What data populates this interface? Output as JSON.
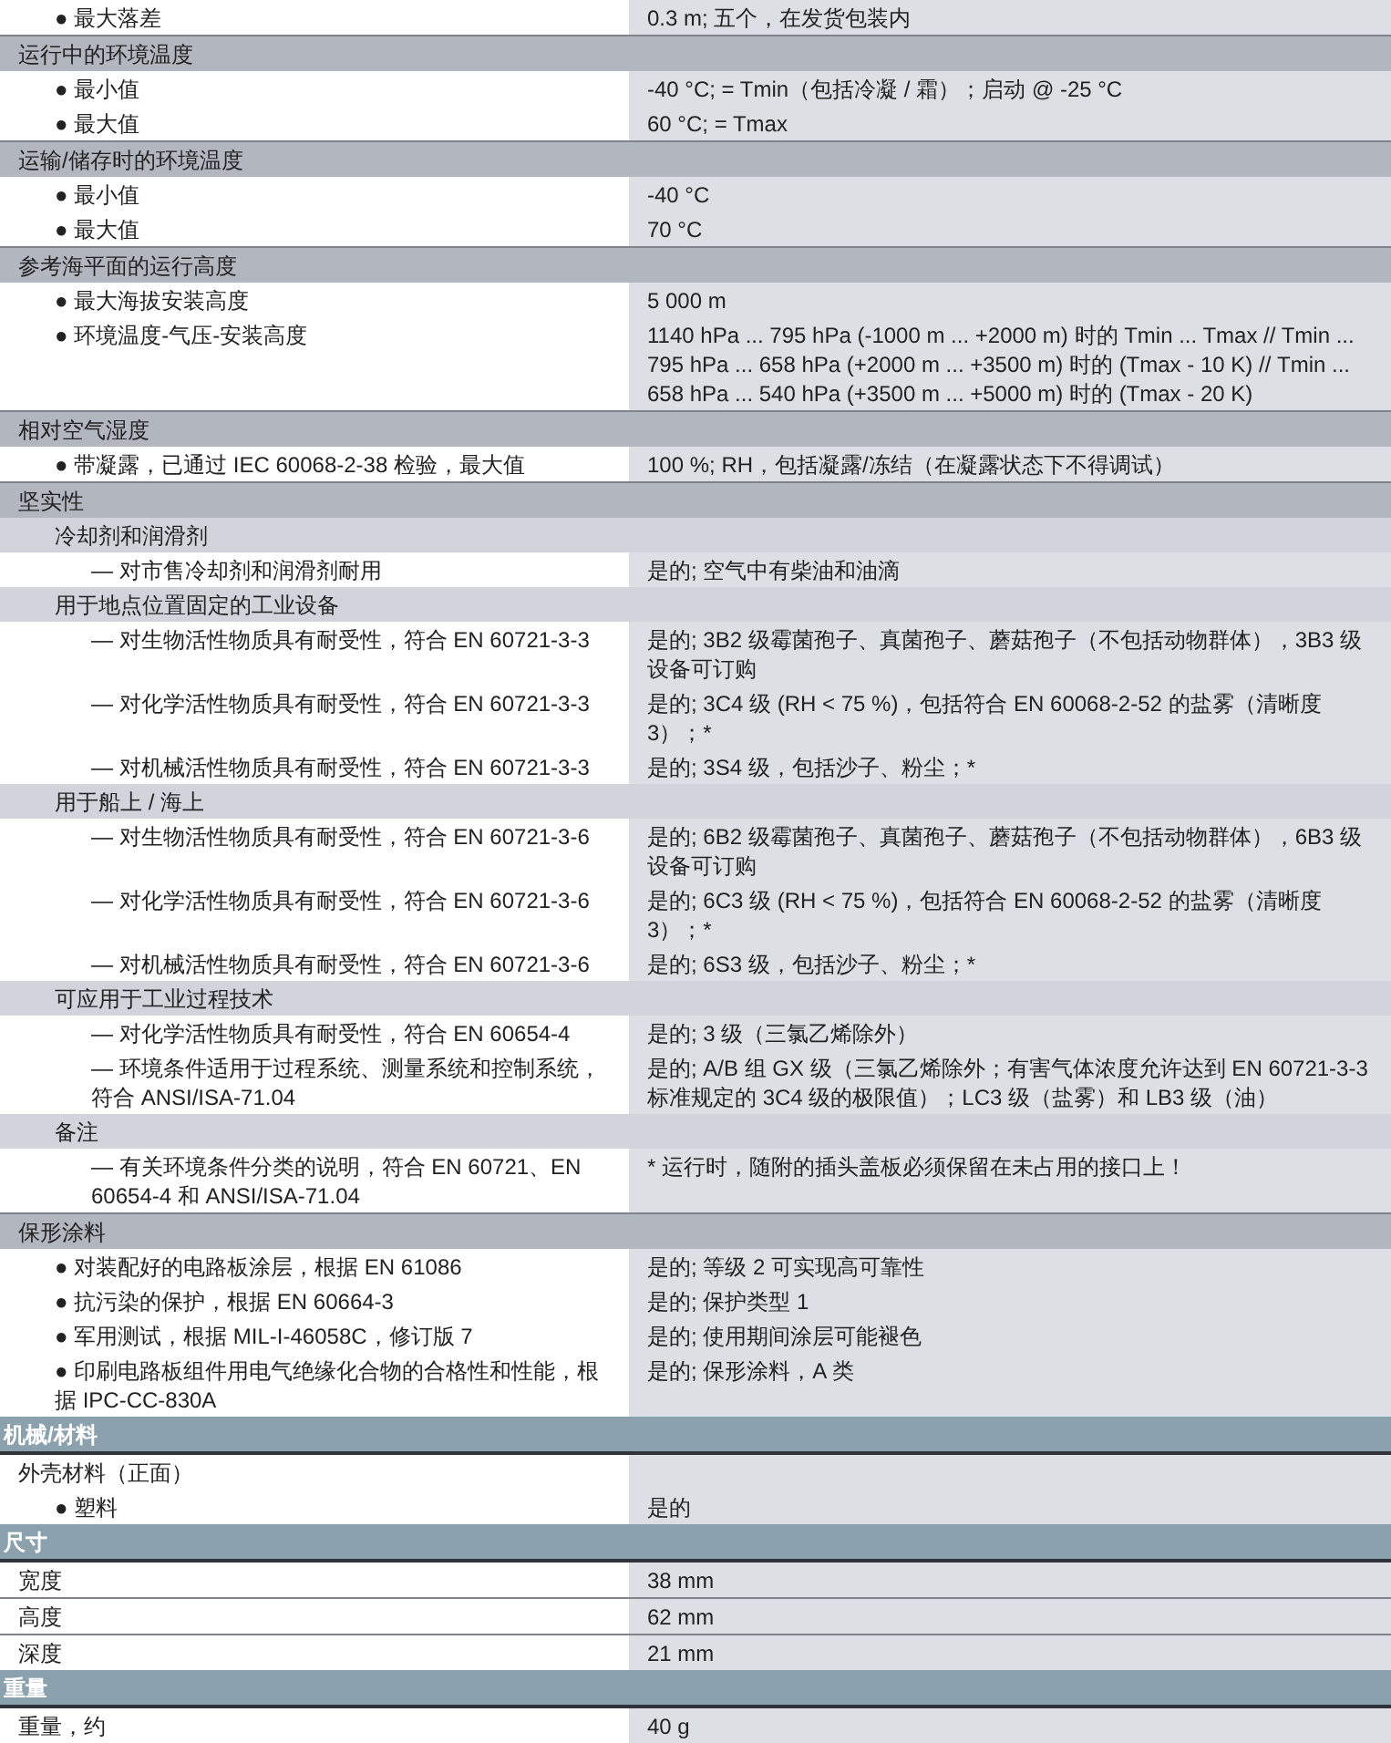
{
  "rows": [
    {
      "kind": "continuation",
      "children": [
        {
          "kind": "item",
          "label": "● 最大落差",
          "value": "0.3 m; 五个，在发货包装内"
        }
      ]
    },
    {
      "kind": "group",
      "label": "运行中的环境温度",
      "children": [
        {
          "kind": "item",
          "label": "● 最小值",
          "value": "-40 °C; = Tmin（包括冷凝 / 霜）；启动 @ -25 °C"
        },
        {
          "kind": "item",
          "label": "● 最大值",
          "value": "60 °C; = Tmax"
        }
      ]
    },
    {
      "kind": "group",
      "label": "运输/储存时的环境温度",
      "children": [
        {
          "kind": "item",
          "label": "● 最小值",
          "value": "-40 °C"
        },
        {
          "kind": "item",
          "label": "● 最大值",
          "value": "70 °C"
        }
      ]
    },
    {
      "kind": "group",
      "label": "参考海平面的运行高度",
      "children": [
        {
          "kind": "item",
          "label": "● 最大海拔安装高度",
          "value": "5 000 m"
        },
        {
          "kind": "item",
          "label": "● 环境温度-气压-安装高度",
          "value": [
            "1140 hPa ... 795 hPa (-1000 m ... +2000 m) 时的 Tmin ... Tmax // Tmin ...",
            "795 hPa ... 658 hPa (+2000 m ... +3500 m) 时的 (Tmax - 10 K) // Tmin ...",
            "658 hPa ... 540 hPa (+3500 m ... +5000 m) 时的 (Tmax - 20 K)"
          ]
        }
      ]
    },
    {
      "kind": "group",
      "label": "相对空气湿度",
      "children": [
        {
          "kind": "item",
          "label": "● 带凝露，已通过 IEC 60068-2-38 检验，最大值",
          "value": "100 %; RH，包括凝露/冻结（在凝露状态下不得调试）"
        }
      ]
    },
    {
      "kind": "group",
      "label": "坚实性",
      "children": [
        {
          "kind": "subgroup",
          "label": "冷却剂和润滑剂",
          "children": [
            {
              "kind": "item",
              "label": "— 对市售冷却剂和润滑剂耐用",
              "value": "是的; 空气中有柴油和油滴"
            }
          ]
        },
        {
          "kind": "subgroup",
          "label": "用于地点位置固定的工业设备",
          "children": [
            {
              "kind": "item",
              "label": "— 对生物活性物质具有耐受性，符合 EN 60721-3-3",
              "value": "是的; 3B2 级霉菌孢子、真菌孢子、蘑菇孢子（不包括动物群体），3B3 级设备可订购"
            },
            {
              "kind": "item",
              "label": "— 对化学活性物质具有耐受性，符合 EN 60721-3-3",
              "value": "是的; 3C4 级 (RH < 75 %)，包括符合 EN 60068-2-52 的盐雾（清晰度 3）；*"
            },
            {
              "kind": "item",
              "label": "— 对机械活性物质具有耐受性，符合 EN 60721-3-3",
              "value": "是的; 3S4 级，包括沙子、粉尘；*"
            }
          ]
        },
        {
          "kind": "subgroup",
          "label": "用于船上 / 海上",
          "children": [
            {
              "kind": "item",
              "label": "— 对生物活性物质具有耐受性，符合 EN 60721-3-6",
              "value": "是的; 6B2 级霉菌孢子、真菌孢子、蘑菇孢子（不包括动物群体），6B3 级设备可订购"
            },
            {
              "kind": "item",
              "label": "— 对化学活性物质具有耐受性，符合 EN 60721-3-6",
              "value": "是的; 6C3 级 (RH < 75 %)，包括符合 EN 60068-2-52 的盐雾（清晰度 3）；*"
            },
            {
              "kind": "item",
              "label": "— 对机械活性物质具有耐受性，符合 EN 60721-3-6",
              "value": "是的; 6S3 级，包括沙子、粉尘；*"
            }
          ]
        },
        {
          "kind": "subgroup",
          "label": "可应用于工业过程技术",
          "children": [
            {
              "kind": "item",
              "label": "— 对化学活性物质具有耐受性，符合 EN 60654-4",
              "value": "是的; 3 级（三氯乙烯除外）"
            },
            {
              "kind": "item",
              "label": "— 环境条件适用于过程系统、测量系统和控制系统，符合 ANSI/ISA-71.04",
              "value": "是的; A/B 组 GX 级（三氯乙烯除外；有害气体浓度允许达到 EN 60721-3-3 标准规定的 3C4 级的极限值）；LC3 级（盐雾）和 LB3 级（油）"
            }
          ]
        },
        {
          "kind": "subgroup",
          "label": "备注",
          "children": [
            {
              "kind": "item",
              "label": "— 有关环境条件分类的说明，符合 EN 60721、EN 60654-4 和 ANSI/ISA-71.04",
              "value": "* 运行时，随附的插头盖板必须保留在未占用的接口上！"
            }
          ]
        }
      ]
    },
    {
      "kind": "group",
      "label": "保形涂料",
      "children": [
        {
          "kind": "item",
          "label": "● 对装配好的电路板涂层，根据 EN 61086",
          "value": "是的; 等级 2 可实现高可靠性"
        },
        {
          "kind": "item",
          "label": "● 抗污染的保护，根据 EN 60664-3",
          "value": "是的; 保护类型 1"
        },
        {
          "kind": "item",
          "label": "● 军用测试，根据 MIL-I-46058C，修订版 7",
          "value": "是的; 使用期间涂层可能褪色"
        },
        {
          "kind": "item",
          "label": "● 印刷电路板组件用电气绝缘化合物的合格性和性能，根据 IPC-CC-830A",
          "value": "是的; 保形涂料，A 类"
        }
      ]
    },
    {
      "kind": "section",
      "label": "机械/材料",
      "children": [
        {
          "kind": "item",
          "label": "外壳材料（正面）",
          "children": [
            {
              "kind": "item",
              "label": "● 塑料",
              "value": "是的"
            }
          ]
        }
      ]
    },
    {
      "kind": "section",
      "label": "尺寸",
      "children": [
        {
          "kind": "item",
          "label": "宽度",
          "value": "38 mm"
        },
        {
          "kind": "item",
          "label": "高度",
          "value": "62 mm"
        },
        {
          "kind": "item",
          "label": "深度",
          "value": "21 mm"
        }
      ]
    },
    {
      "kind": "section",
      "label": "重量",
      "children": [
        {
          "kind": "item",
          "label": "重量，约",
          "value": "40 g"
        }
      ]
    }
  ]
}
